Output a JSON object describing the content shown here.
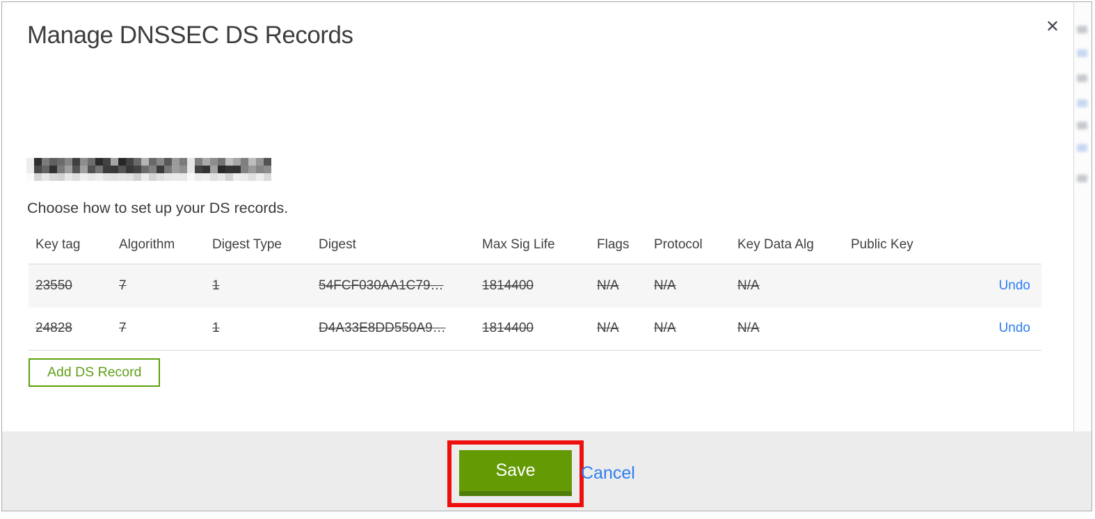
{
  "modal": {
    "title": "Manage DNSSEC DS Records",
    "close_glyph": "✕",
    "instruction": "Choose how to set up your DS records.",
    "table": {
      "columns": [
        "Key tag",
        "Algorithm",
        "Digest Type",
        "Digest",
        "Max Sig Life",
        "Flags",
        "Protocol",
        "Key Data Alg",
        "Public Key"
      ],
      "rows": [
        {
          "key_tag": "23550",
          "algorithm": "7",
          "digest_type": "1",
          "digest": "54FCF030AA1C79…",
          "max_sig_life": "1814400",
          "flags": "N/A",
          "protocol": "N/A",
          "key_data_alg": "N/A",
          "public_key": "",
          "action": "Undo",
          "state": "marked-for-deletion"
        },
        {
          "key_tag": "24828",
          "algorithm": "7",
          "digest_type": "1",
          "digest": "D4A33E8DD550A9…",
          "max_sig_life": "1814400",
          "flags": "N/A",
          "protocol": "N/A",
          "key_data_alg": "N/A",
          "public_key": "",
          "action": "Undo",
          "state": "marked-for-deletion"
        }
      ]
    },
    "add_button_label": "Add DS Record",
    "footer": {
      "save_label": "Save",
      "cancel_label": "Cancel"
    }
  },
  "colors": {
    "accent_green": "#649b05",
    "green_border": "#59a008",
    "link_blue": "#2c7ef2",
    "annotation_red": "#ee0f0f",
    "footer_gray": "#ececec"
  }
}
